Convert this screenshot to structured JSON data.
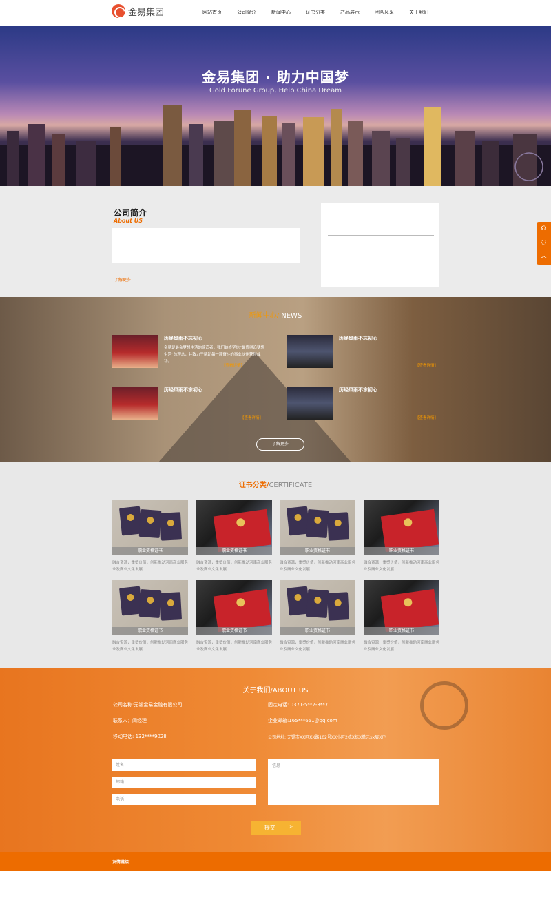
{
  "header": {
    "brand": "金易集团",
    "nav": [
      "网站首页",
      "公司简介",
      "新闻中心",
      "证书分类",
      "产品展示",
      "团队风采",
      "关于我们"
    ]
  },
  "banner": {
    "title": "金易集团 · 助力中国梦",
    "subtitle": "Gold Forune Group, Help China Dream"
  },
  "about": {
    "title": "公司简介",
    "title_en": "About US",
    "more": "了解更多"
  },
  "news": {
    "title_cn": "新闻中心/",
    "title_en": " NEWS",
    "items": [
      {
        "title": "历经风雨不忘初心",
        "text": "金易是最会梦想生活的缔造者，我们始终坚信“最值得追梦想生活”的理念，并致力于帮助每一颗奋斗的事业伙伴获得成功。",
        "more": "【查看详情】"
      },
      {
        "title": "历经风雨不忘初心",
        "text": "",
        "more": "【查看详情】"
      },
      {
        "title": "历经风雨不忘初心",
        "text": "",
        "more": "【查看详情】"
      },
      {
        "title": "历经风雨不忘初心",
        "text": "",
        "more": "【查看详情】"
      }
    ],
    "button": "了解更多"
  },
  "certificates": {
    "title_cn": "证书分类/",
    "title_en": "CERTIFICATE",
    "items": [
      {
        "label": "职业资格证书",
        "desc": "融合资源，重塑价值，创新推动河南商业服务业及商业文化发展",
        "style": "blue"
      },
      {
        "label": "职业资格证书",
        "desc": "融合资源，重塑价值，创新推动河南商业服务业及商业文化发展",
        "style": "red"
      },
      {
        "label": "职业资格证书",
        "desc": "融合资源，重塑价值，创新推动河南商业服务业及商业文化发展",
        "style": "blue"
      },
      {
        "label": "职业资格证书",
        "desc": "融合资源，重塑价值，创新推动河南商业服务业及商业文化发展",
        "style": "red"
      },
      {
        "label": "职业资格证书",
        "desc": "融合资源，重塑价值，创新推动河南商业服务业及商业文化发展",
        "style": "blue"
      },
      {
        "label": "职业资格证书",
        "desc": "融合资源，重塑价值，创新推动河南商业服务业及商业文化发展",
        "style": "red"
      },
      {
        "label": "职业资格证书",
        "desc": "融合资源，重塑价值，创新推动河南商业服务业及商业文化发展",
        "style": "blue"
      },
      {
        "label": "职业资格证书",
        "desc": "融合资源，重塑价值，创新推动河南商业服务业及商业文化发展",
        "style": "red"
      }
    ]
  },
  "contact": {
    "title": "关于我们/ABOUT US",
    "company": "公司名称:无锡金易金融有限公司",
    "person": "联系人：闫经理",
    "mobile": "移动电话: 132****9028",
    "phone": "固定电话: 0371-5**2-3**7",
    "email": "企业邮箱:165***651@qq.com",
    "address": "公司地址: 无锡市XX区XX路102号XX小区2栋X栋X单元xx层X户",
    "name_placeholder": "姓名",
    "email_placeholder": "邮箱",
    "phone_placeholder": "电话",
    "message_placeholder": "信息",
    "submit": "提交"
  },
  "footer": {
    "links_label": "友情链接："
  },
  "colors": {
    "accent": "#ed6c00",
    "submit": "#f6b332"
  }
}
